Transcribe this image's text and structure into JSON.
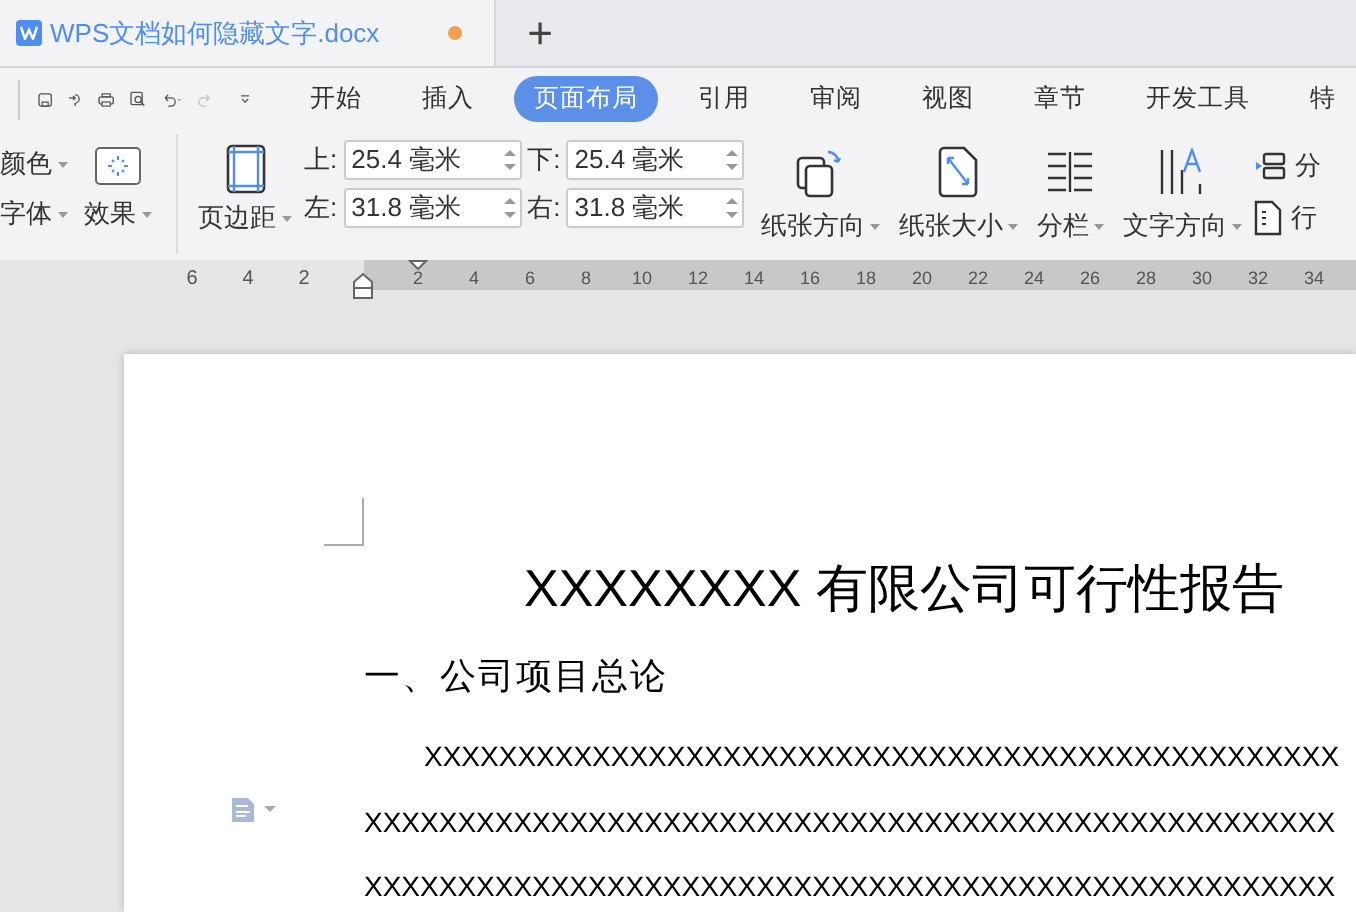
{
  "document_tab": {
    "title": "WPS文档如何隐藏文字.docx",
    "modified": true
  },
  "new_tab_label": "+",
  "menu_tabs": [
    {
      "label": "开始",
      "selected": false
    },
    {
      "label": "插入",
      "selected": false
    },
    {
      "label": "页面布局",
      "selected": true
    },
    {
      "label": "引用",
      "selected": false
    },
    {
      "label": "审阅",
      "selected": false
    },
    {
      "label": "视图",
      "selected": false
    },
    {
      "label": "章节",
      "selected": false
    },
    {
      "label": "开发工具",
      "selected": false
    },
    {
      "label": "特",
      "selected": false
    }
  ],
  "ribbon": {
    "left_cut": [
      "颜色",
      "字体"
    ],
    "effects": "效果",
    "margins_button": "页边距",
    "margin_fields": [
      {
        "label": "上:",
        "value": "25.4 毫米"
      },
      {
        "label": "下:",
        "value": "25.4 毫米"
      },
      {
        "label": "左:",
        "value": "31.8 毫米"
      },
      {
        "label": "右:",
        "value": "31.8 毫米"
      }
    ],
    "big_buttons": [
      {
        "kind": "orientation",
        "label": "纸张方向"
      },
      {
        "kind": "size",
        "label": "纸张大小"
      },
      {
        "kind": "columns",
        "label": "分栏"
      },
      {
        "kind": "text_direction",
        "label": "文字方向"
      }
    ],
    "small_buttons": [
      {
        "kind": "breaks",
        "label": "分"
      },
      {
        "kind": "line_numbers",
        "label": "行"
      }
    ]
  },
  "ruler": {
    "left_ticks": [
      "6",
      "4",
      "2"
    ],
    "ticks": [
      "2",
      "4",
      "6",
      "8",
      "10",
      "12",
      "14",
      "16",
      "18",
      "20",
      "22",
      "24",
      "26",
      "28",
      "30",
      "32",
      "34"
    ]
  },
  "document": {
    "title": "XXXXXXXX 有限公司可行性报告",
    "heading": "一、公司项目总论",
    "lines": [
      "XXXXXXXXXXXXXXXXXXXXXXXXXXXXXXXXXXXXXXXXXXXXXXXXX",
      "XXXXXXXXXXXXXXXXXXXXXXXXXXXXXXXXXXXXXXXXXXXXXXXXXXXX",
      "XXXXXXXXXXXXXXXXXXXXXXXXXXXXXXXXXXXXXXXXXXXXXXXXXXXX"
    ]
  }
}
